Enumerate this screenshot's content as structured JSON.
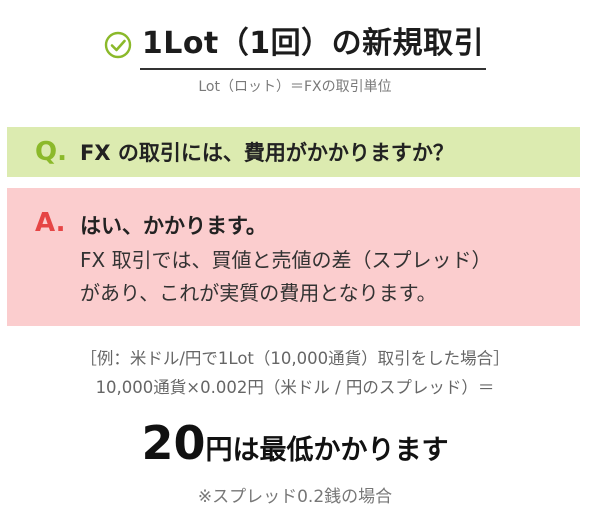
{
  "header": {
    "title": "1Lot（1回）の新規取引",
    "subtitle": "Lot（ロット）＝FXの取引単位",
    "icon": "check-circle-icon",
    "accent_color": "#8bb92a"
  },
  "question": {
    "mark": "Q.",
    "text": "FX の取引には、費用がかかりますか？",
    "bg_color": "#dcebb0"
  },
  "answer": {
    "mark": "A.",
    "lead": "はい、かかります。",
    "body_lines": [
      "FX 取引では、買値と売値の差（スプレッド）",
      "があり、これが実質の費用となります。"
    ],
    "bg_color": "#fbcdce",
    "mark_color": "#e64545"
  },
  "example": {
    "lines": [
      "［例：米ドル/円で1Lot（10,000通貨）取引をした場合］",
      "10,000通貨×0.002円（米ドル / 円のスプレッド）＝"
    ]
  },
  "result": {
    "number": "20",
    "text": "円は最低かかります"
  },
  "note": "※スプレッド0.2銭の場合"
}
